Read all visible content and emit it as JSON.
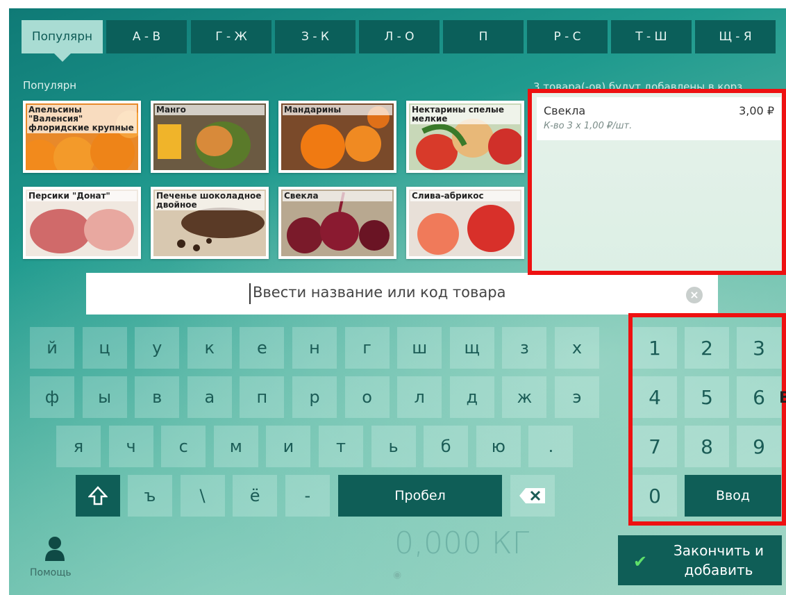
{
  "tabs": [
    "Популярн",
    "А - В",
    "Г - Ж",
    "З - К",
    "Л - О",
    "П",
    "Р - С",
    "Т - Ш",
    "Щ - Я"
  ],
  "section_label": "Популярн",
  "cart_count_text": "3 товара(-ов) будут добавлены в корз",
  "products": [
    {
      "name": "Апельсины \"Валенсия\" флоридские крупные",
      "icon": "orange-photo"
    },
    {
      "name": "Манго",
      "icon": "mango-photo"
    },
    {
      "name": "Мандарины",
      "icon": "tangerine-photo"
    },
    {
      "name": "Нектарины спелые мелкие",
      "icon": "nectarine-photo"
    },
    {
      "name": "Персики \"Донат\"",
      "icon": "peach-photo"
    },
    {
      "name": "Печенье шоколадное двойное",
      "icon": "cookie-photo"
    },
    {
      "name": "Свекла",
      "icon": "beet-photo"
    },
    {
      "name": "Слива-абрикос",
      "icon": "plumcot-photo"
    }
  ],
  "cart": {
    "items": [
      {
        "name": "Свекла",
        "price": "3,00 ₽",
        "qty": "К-во 3  х 1,00 ₽/шт."
      }
    ]
  },
  "search": {
    "placeholder": "Ввести название или код товара"
  },
  "keyboard": {
    "row1": [
      "й",
      "ц",
      "у",
      "к",
      "е",
      "н",
      "г",
      "ш",
      "щ",
      "з",
      "х"
    ],
    "row2": [
      "ф",
      "ы",
      "в",
      "а",
      "п",
      "р",
      "о",
      "л",
      "д",
      "ж",
      "э"
    ],
    "row3": [
      "я",
      "ч",
      "с",
      "м",
      "и",
      "т",
      "ь",
      "б",
      "ю",
      "."
    ],
    "row4": [
      "ъ",
      "\\",
      "ё",
      "-"
    ],
    "space_label": "Пробел"
  },
  "numpad": {
    "keys": [
      "1",
      "2",
      "3",
      "4",
      "5",
      "6",
      "7",
      "8",
      "9",
      "0"
    ],
    "enter_label": "Ввод"
  },
  "weight": "0,000 КГ",
  "help_label": "Помощь",
  "finish_label": "Закончить и добавить",
  "stray_char": "В",
  "colors": {
    "accent": "#0f5e57",
    "highlight": "#ee1111",
    "active_tab": "#a9dcd3"
  }
}
